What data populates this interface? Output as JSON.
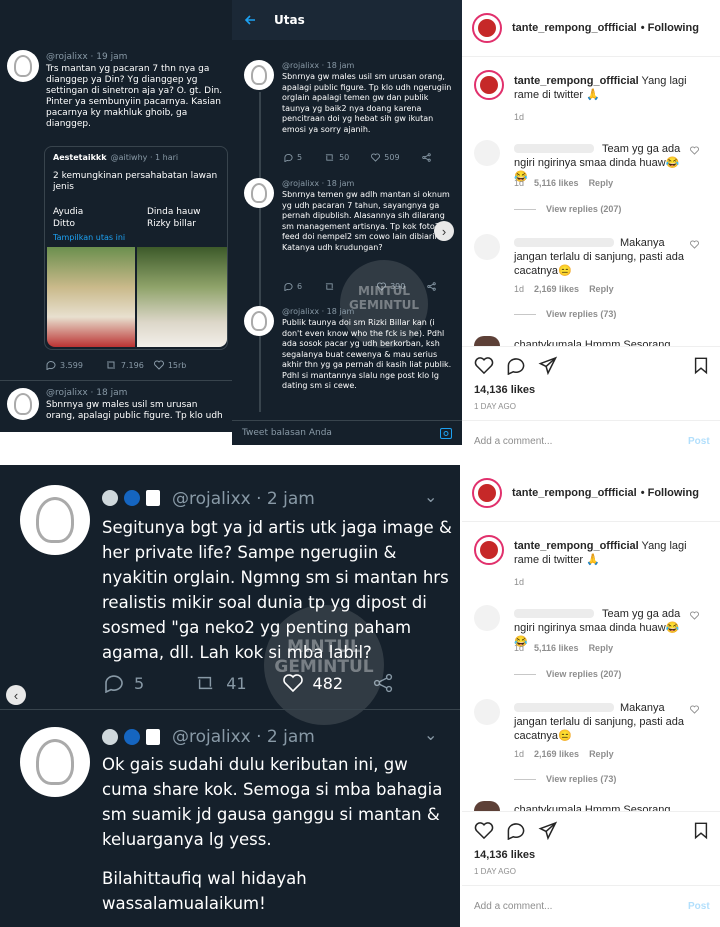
{
  "colors": {
    "twitter_bg": "#15202b",
    "twitter_link": "#1da1f2",
    "ig_text": "#262626",
    "ig_gray": "#8e8e8e",
    "ig_blue": "#b2dffc"
  },
  "top_left": {
    "tweet1": {
      "handle": "@rojalixx · 19 jam",
      "text": "Trs mantan yg pacaran 7 thn nya ga dianggep ya Din? Yg dianggep yg settingan di sinetron aja ya? O. gt. Din. Pinter ya sembunyiin pacarnya. Kasian pacarnya ky makhluk ghoib, ga dianggep."
    },
    "quote": {
      "name": "Aestetaikkk",
      "handle": "@aitiwhy · 1 hari",
      "text": "2 kemungkinan persahabatan lawan jenis",
      "left_1": "Ayudia",
      "left_2": "Ditto",
      "right_1": "Dinda hauw",
      "right_2": "Rizky billar",
      "show_thread": "Tampilkan utas ini"
    },
    "stats": {
      "replies": "3.599",
      "retweets": "7.196",
      "likes": "15rb"
    },
    "tweet2": {
      "handle": "@rojalixx · 18 jam",
      "text": "Sbnrnya gw males usil sm urusan orang, apalagi public figure. Tp klo udh"
    }
  },
  "top_middle": {
    "header_title": "Utas",
    "tweet1": {
      "handle": "@rojalixx · 18 jam",
      "text": "Sbnrnya gw males usil sm urusan orang, apalagi public figure. Tp klo udh ngerugiin orglain apalagi temen gw dan publik taunya yg baik2 nya doang karena pencitraan doi yg hebat sih gw ikutan emosi ya sorry ajanih.",
      "replies": "5",
      "retweets": "50",
      "likes": "509"
    },
    "tweet2": {
      "handle": "@rojalixx · 18 jam",
      "text": "Sbnrnya temen gw adlh mantan si oknum yg udh pacaran 7 tahun, sayangnya ga pernah dipublish. Alasannya sih dilarang sm management artisnya. Tp kok foto2 di feed doi nempel2 sm cowo lain dibiarin? Katanya udh krudungan?",
      "replies": "6",
      "likes": "390"
    },
    "tweet3": {
      "handle": "@rojalixx · 18 jam",
      "text": "Publik taunya doi sm Rizki Billar kan (i don't even know who the fck is he). Pdhl ada sosok pacar yg udh berkorban, ksh segalanya buat cewenya & mau serius akhir thn yg ga pernah di kasih liat publik. Pdhl si mantannya slalu nge post klo lg dating sm si cewe."
    },
    "reply_placeholder": "Tweet balasan Anda",
    "watermark_1": "MINTUL",
    "watermark_2": "GEMINTUL"
  },
  "bottom_left": {
    "tweet1": {
      "handle": "@rojalixx · 2 jam",
      "text": "Segitunya bgt ya jd artis utk jaga image & her private life? Sampe ngerugiin & nyakitin orglain. Ngmng sm si mantan hrs realistis mikir soal dunia tp yg dipost di sosmed \"ga neko2 yg penting paham agama, dll. Lah kok si mba labil?",
      "replies": "5",
      "retweets": "41",
      "likes": "482"
    },
    "tweet2": {
      "handle": "@rojalixx · 2 jam",
      "text": "Ok gais sudahi dulu keributan ini, gw cuma share kok. Semoga si mba bahagia sm suamik jd gausa ganggu si mantan & keluarganya lg yess.",
      "text2": "Bilahittaufiq wal hidayah wassalamualaikum!"
    },
    "watermark_1": "MINTUL",
    "watermark_2": "GEMINTUL"
  },
  "instagram": {
    "account": "tante_rempong_offficial",
    "following": "• Following",
    "caption": "Yang lagi rame di twitter 🙏",
    "caption_time": "1d",
    "comment1": {
      "text": "Team yg ga ada ngiri ngirinya smaa dinda huaw😂😂",
      "time": "1d",
      "likes": "5,116 likes",
      "reply": "Reply",
      "view_replies": "View replies (207)"
    },
    "comment2": {
      "text": "Makanya jangan terlalu di sanjung, pasti ada cacatnya😑",
      "time": "1d",
      "likes": "2,169 likes",
      "reply": "Reply",
      "view_replies": "View replies (73)"
    },
    "comment3_partial": "chantykumala Hmmm Sesorang",
    "likes": "14,136 likes",
    "date": "1 DAY AGO",
    "add_comment": "Add a comment...",
    "post": "Post"
  }
}
